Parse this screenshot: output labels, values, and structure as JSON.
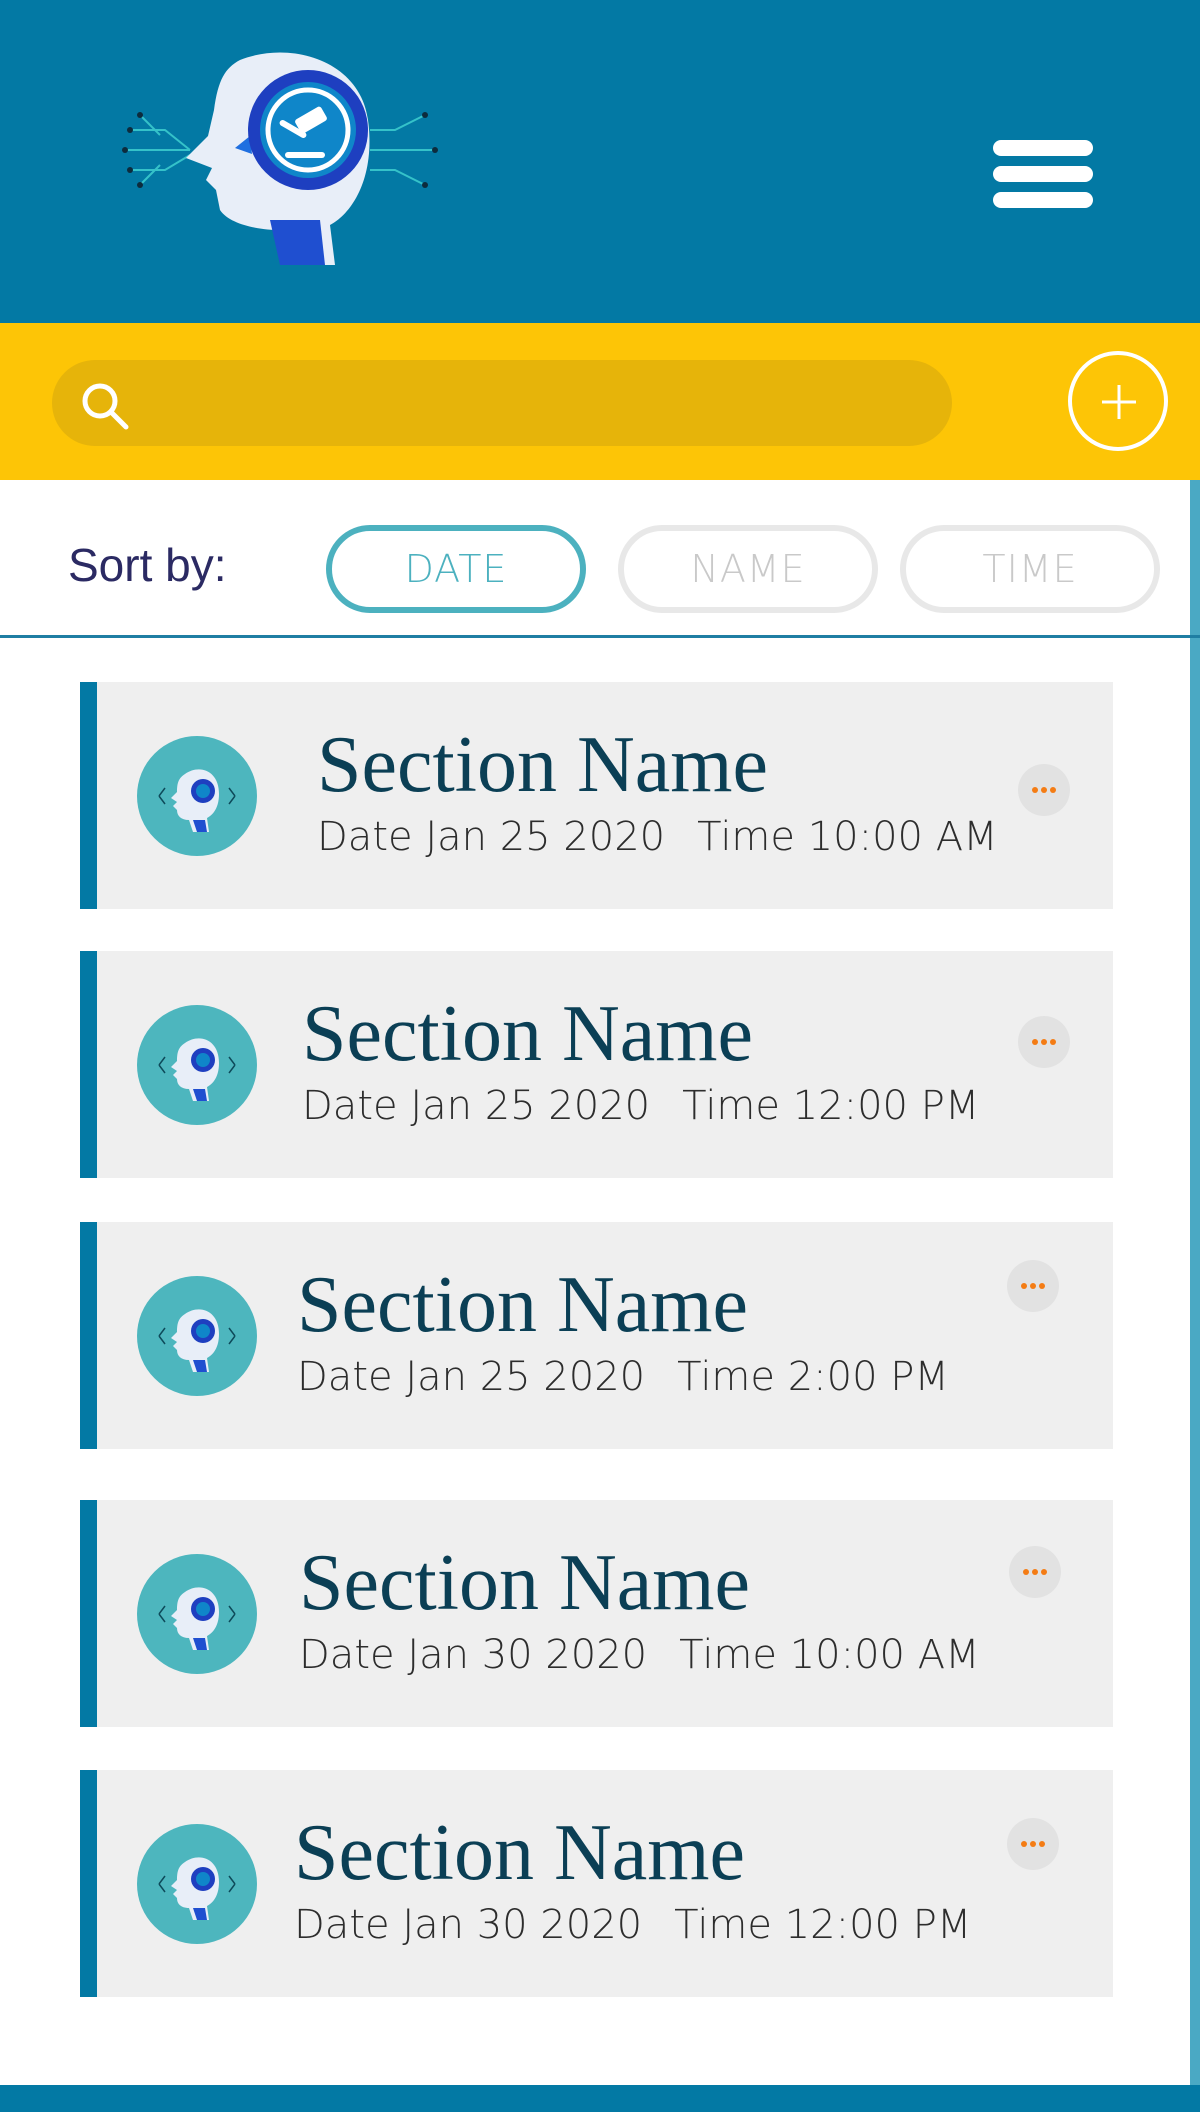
{
  "search": {
    "placeholder": ""
  },
  "sort": {
    "label": "Sort by:",
    "options": [
      {
        "label": "DATE",
        "active": true
      },
      {
        "label": "NAME",
        "active": false
      },
      {
        "label": "TIME",
        "active": false
      }
    ]
  },
  "sections": [
    {
      "title": "Section Name",
      "date": "Date Jan 25 2020",
      "time": "Time 10:00 AM"
    },
    {
      "title": "Section Name",
      "date": "Date Jan 25 2020",
      "time": "Time 12:00 PM"
    },
    {
      "title": "Section Name",
      "date": "Date Jan 25 2020",
      "time": "Time 2:00 PM"
    },
    {
      "title": "Section Name",
      "date": "Date Jan 30 2020",
      "time": "Time 10:00 AM"
    },
    {
      "title": "Section Name",
      "date": "Date Jan 30 2020",
      "time": "Time 12:00 PM"
    }
  ],
  "icons": {
    "logo": "robot-head-gavel-logo",
    "menu": "hamburger-menu-icon",
    "search": "search-icon",
    "add": "plus-icon",
    "more": "ellipsis-icon",
    "avatar": "robot-avatar-icon"
  },
  "colors": {
    "header": "#0379a4",
    "searchbar": "#fdc506",
    "accent": "#4cb1bf",
    "title": "#0b3f55",
    "more_dots": "#f47c14"
  }
}
